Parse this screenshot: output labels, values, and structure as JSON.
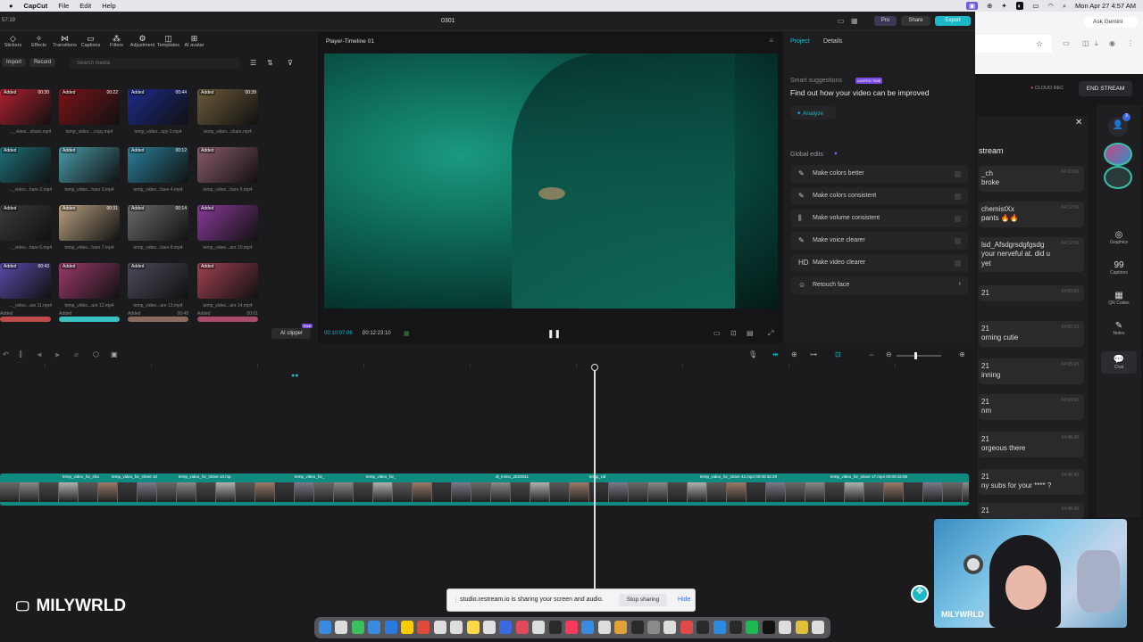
{
  "menubar": {
    "app": "CapCut",
    "items": [
      "File",
      "Edit",
      "Help"
    ],
    "datetime": "Mon Apr 27  4:57 AM"
  },
  "window": {
    "title": "0301",
    "time_left": "57:19",
    "pro_label": "Pro",
    "share_label": "Share",
    "export_label": "Export"
  },
  "tools": [
    "Stickers",
    "Effects",
    "Transitions",
    "Captions",
    "Filters",
    "Adjustment",
    "Templates",
    "AI avatar"
  ],
  "media": {
    "import_label": "Import",
    "record_label": "Record",
    "search_placeholder": "Search media",
    "ai_clipper_label": "AI clipper",
    "ai_clipper_badge": "Free",
    "tiles": [
      {
        "tag": "Added",
        "dur": "00:30",
        "cap": "..._video...share.mp4",
        "color": "#b0202f"
      },
      {
        "tag": "Added",
        "dur": "00:22",
        "cap": "temp_video....copy.mp4",
        "color": "#7a1218"
      },
      {
        "tag": "Added",
        "dur": "00:44",
        "cap": "temp_video...opy 2.mp4",
        "color": "#1d2a8a"
      },
      {
        "tag": "Added",
        "dur": "00:39",
        "cap": "temp_video...share.mp4",
        "color": "#6b5a3a"
      },
      {
        "tag": "Added",
        "dur": "",
        "cap": "..._video...hare 2.mp4",
        "color": "#1f6f7a"
      },
      {
        "tag": "Added",
        "dur": "",
        "cap": "temp_video...hare 3.mp4",
        "color": "#4a9aa8"
      },
      {
        "tag": "Added",
        "dur": "00:12",
        "cap": "temp_video...hare 4.mp4",
        "color": "#2a7f9a"
      },
      {
        "tag": "Added",
        "dur": "",
        "cap": "temp_video...hare 5.mp4",
        "color": "#8a5a6a"
      },
      {
        "tag": "Added",
        "dur": "",
        "cap": "..._video...hare 6.mp4",
        "color": "#3a3a3a"
      },
      {
        "tag": "Added",
        "dur": "00:31",
        "cap": "temp_video...hare 7.mp4",
        "color": "#b8a080"
      },
      {
        "tag": "Added",
        "dur": "00:14",
        "cap": "temp_video...hare 8.mp4",
        "color": "#6a6a6a"
      },
      {
        "tag": "Added",
        "dur": "",
        "cap": "temp_video...are 10.mp4",
        "color": "#8a3a9a"
      },
      {
        "tag": "Added",
        "dur": "00:43",
        "cap": "..._video...are 11.mp4",
        "color": "#5a4aa8"
      },
      {
        "tag": "Added",
        "dur": "",
        "cap": "temp_video...are 12.mp4",
        "color": "#9a3a6a"
      },
      {
        "tag": "Added",
        "dur": "",
        "cap": "temp_video...are 13.mp4",
        "color": "#4a4a5a"
      },
      {
        "tag": "Added",
        "dur": "",
        "cap": "temp_video...are 14.mp4",
        "color": "#a04050"
      }
    ],
    "row5_durs": [
      "",
      "",
      "00:48",
      "00:01"
    ]
  },
  "player": {
    "title": "Player-Timeline 01",
    "current_time": "00:10:07:06",
    "total_time": "00:12:23:10"
  },
  "right_panel": {
    "tab_project": "Project",
    "tab_details": "Details",
    "smart_title": "Smart suggestions",
    "smart_badge": "LIMITED TIME",
    "smart_heading": "Find out how your video can be improved",
    "analyze_label": "Analyze",
    "global_edits": "Global edits",
    "edits": [
      {
        "icon": "✎",
        "label": "Make colors better"
      },
      {
        "icon": "✎",
        "label": "Make colors consistent"
      },
      {
        "icon": "⫼",
        "label": "Make volume consistent"
      },
      {
        "icon": "✎",
        "label": "Make voice clearer"
      },
      {
        "icon": "HD",
        "label": "Make video clearer"
      },
      {
        "icon": "☺",
        "label": "Retouch face"
      }
    ]
  },
  "timeline": {
    "clip_labels": [
      "temp_video_for_sha",
      "temp_video_for_share 10",
      "temp_video_for_share 10.mp",
      "temp_video_for_",
      "temp_video_for_",
      "dl_mimo_2023021",
      "temp_vid",
      "temp_video_for_share 42.mp4 00:00:32:29",
      "temp_video_for_share 17.mp4 00:00:42:06"
    ]
  },
  "browser": {
    "ask_gemini": "Ask Gemini",
    "cloud_rec": "CLOUD REC",
    "end_stream": "END STREAM",
    "chat_title": "stream",
    "chats": [
      {
        "text": "_ch\nbroke",
        "time": "04:10:06"
      },
      {
        "text": "chemistXx\npants 🔥🔥",
        "time": "04:12:00"
      },
      {
        "text": "lsd_Afsdgrsdgfgsdg\nyour nerveful at. did u\nyet",
        "time": "04:12:00"
      },
      {
        "text": "21",
        "time": "04:00:00"
      },
      {
        "text": "21\norning cutie",
        "time": "04:00:15"
      },
      {
        "text": "21\ninning",
        "time": "04:05:43"
      },
      {
        "text": "21\nnm",
        "time": "04:06:50"
      },
      {
        "text": "21\norgeous there",
        "time": "04:45:40"
      },
      {
        "text": "21\nny subs for your **** ?",
        "time": "04:46:40"
      },
      {
        "text": "21",
        "time": "04:46:40"
      }
    ],
    "side": [
      {
        "icon": "◎",
        "label": "Graphics"
      },
      {
        "icon": "99",
        "label": "Captions"
      },
      {
        "icon": "▦",
        "label": "QR Codes"
      },
      {
        "icon": "✎",
        "label": "Notes"
      },
      {
        "icon": "💬",
        "label": "Chat"
      }
    ],
    "notif_count": "3"
  },
  "share_bar": {
    "text": "studio.restream.io is sharing your screen and audio.",
    "stop_label": "Stop sharing",
    "hide_label": "Hide"
  },
  "overlay": {
    "watermark": "MILYWRLD",
    "webcam_name": "MILYWRLD"
  }
}
